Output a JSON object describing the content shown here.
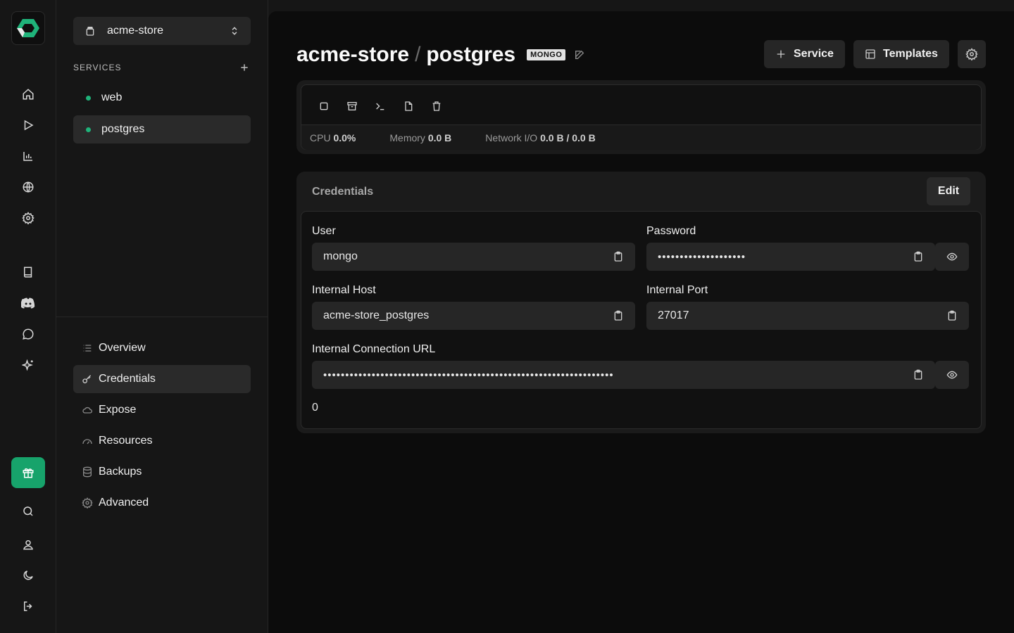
{
  "project": {
    "name": "acme-store"
  },
  "services": {
    "heading": "SERVICES",
    "items": [
      {
        "label": "web",
        "status_color": "#1fb37a"
      },
      {
        "label": "postgres",
        "status_color": "#1fb37a"
      }
    ]
  },
  "nav": {
    "items": [
      {
        "label": "Overview",
        "icon": "list-icon"
      },
      {
        "label": "Credentials",
        "icon": "key-icon"
      },
      {
        "label": "Expose",
        "icon": "cloud-icon"
      },
      {
        "label": "Resources",
        "icon": "gauge-icon"
      },
      {
        "label": "Backups",
        "icon": "database-icon"
      },
      {
        "label": "Advanced",
        "icon": "gear-icon"
      }
    ]
  },
  "header": {
    "project": "acme-store",
    "separator": "/",
    "service": "postgres",
    "badge": "MONGO",
    "service_button": "Service",
    "templates_button": "Templates"
  },
  "stats": {
    "cpu_label": "CPU",
    "cpu_value": "0.0%",
    "memory_label": "Memory",
    "memory_value": "0.0 B",
    "network_label": "Network I/O",
    "network_value": "0.0 B / 0.0 B"
  },
  "credentials": {
    "title": "Credentials",
    "edit_label": "Edit",
    "user_label": "User",
    "user_value": "mongo",
    "password_label": "Password",
    "password_value": "••••••••••••••••••••",
    "host_label": "Internal Host",
    "host_value": "acme-store_postgres",
    "port_label": "Internal Port",
    "port_value": "27017",
    "url_label": "Internal Connection URL",
    "url_value": "••••••••••••••••••••••••••••••••••••••••••••••••••••••••••••••••••",
    "footer_value": "0"
  },
  "colors": {
    "accent": "#17a36b",
    "status": "#1fb37a"
  }
}
